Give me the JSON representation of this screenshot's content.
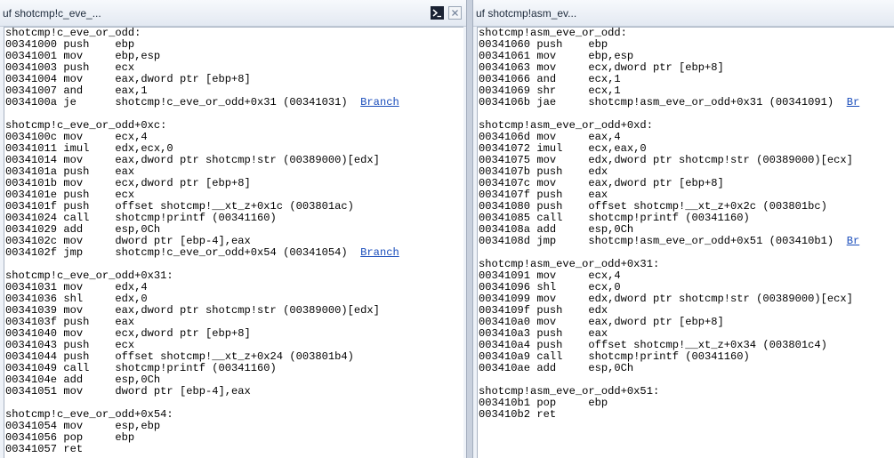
{
  "left": {
    "title": "uf shotcmp!c_eve_...",
    "lines": [
      {
        "text": "shotcmp!c_eve_or_odd:"
      },
      {
        "text": "00341000 push    ebp"
      },
      {
        "text": "00341001 mov     ebp,esp"
      },
      {
        "text": "00341003 push    ecx"
      },
      {
        "text": "00341004 mov     eax,dword ptr [ebp+8]"
      },
      {
        "text": "00341007 and     eax,1"
      },
      {
        "text": "0034100a je      shotcmp!c_eve_or_odd+0x31 (00341031)  ",
        "link": "Branch"
      },
      {
        "text": ""
      },
      {
        "text": "shotcmp!c_eve_or_odd+0xc:"
      },
      {
        "text": "0034100c mov     ecx,4"
      },
      {
        "text": "00341011 imul    edx,ecx,0"
      },
      {
        "text": "00341014 mov     eax,dword ptr shotcmp!str (00389000)[edx]"
      },
      {
        "text": "0034101a push    eax"
      },
      {
        "text": "0034101b mov     ecx,dword ptr [ebp+8]"
      },
      {
        "text": "0034101e push    ecx"
      },
      {
        "text": "0034101f push    offset shotcmp!__xt_z+0x1c (003801ac)"
      },
      {
        "text": "00341024 call    shotcmp!printf (00341160)"
      },
      {
        "text": "00341029 add     esp,0Ch"
      },
      {
        "text": "0034102c mov     dword ptr [ebp-4],eax"
      },
      {
        "text": "0034102f jmp     shotcmp!c_eve_or_odd+0x54 (00341054)  ",
        "link": "Branch"
      },
      {
        "text": ""
      },
      {
        "text": "shotcmp!c_eve_or_odd+0x31:"
      },
      {
        "text": "00341031 mov     edx,4"
      },
      {
        "text": "00341036 shl     edx,0"
      },
      {
        "text": "00341039 mov     eax,dword ptr shotcmp!str (00389000)[edx]"
      },
      {
        "text": "0034103f push    eax"
      },
      {
        "text": "00341040 mov     ecx,dword ptr [ebp+8]"
      },
      {
        "text": "00341043 push    ecx"
      },
      {
        "text": "00341044 push    offset shotcmp!__xt_z+0x24 (003801b4)"
      },
      {
        "text": "00341049 call    shotcmp!printf (00341160)"
      },
      {
        "text": "0034104e add     esp,0Ch"
      },
      {
        "text": "00341051 mov     dword ptr [ebp-4],eax"
      },
      {
        "text": ""
      },
      {
        "text": "shotcmp!c_eve_or_odd+0x54:"
      },
      {
        "text": "00341054 mov     esp,ebp"
      },
      {
        "text": "00341056 pop     ebp"
      },
      {
        "text": "00341057 ret"
      }
    ]
  },
  "right": {
    "title": "uf shotcmp!asm_ev...",
    "lines": [
      {
        "text": "shotcmp!asm_eve_or_odd:"
      },
      {
        "text": "00341060 push    ebp"
      },
      {
        "text": "00341061 mov     ebp,esp"
      },
      {
        "text": "00341063 mov     ecx,dword ptr [ebp+8]"
      },
      {
        "text": "00341066 and     ecx,1"
      },
      {
        "text": "00341069 shr     ecx,1"
      },
      {
        "text": "0034106b jae     shotcmp!asm_eve_or_odd+0x31 (00341091)  ",
        "link": "Br"
      },
      {
        "text": ""
      },
      {
        "text": "shotcmp!asm_eve_or_odd+0xd:"
      },
      {
        "text": "0034106d mov     eax,4"
      },
      {
        "text": "00341072 imul    ecx,eax,0"
      },
      {
        "text": "00341075 mov     edx,dword ptr shotcmp!str (00389000)[ecx]"
      },
      {
        "text": "0034107b push    edx"
      },
      {
        "text": "0034107c mov     eax,dword ptr [ebp+8]"
      },
      {
        "text": "0034107f push    eax"
      },
      {
        "text": "00341080 push    offset shotcmp!__xt_z+0x2c (003801bc)"
      },
      {
        "text": "00341085 call    shotcmp!printf (00341160)"
      },
      {
        "text": "0034108a add     esp,0Ch"
      },
      {
        "text": "0034108d jmp     shotcmp!asm_eve_or_odd+0x51 (003410b1)  ",
        "link": "Br"
      },
      {
        "text": ""
      },
      {
        "text": "shotcmp!asm_eve_or_odd+0x31:"
      },
      {
        "text": "00341091 mov     ecx,4"
      },
      {
        "text": "00341096 shl     ecx,0"
      },
      {
        "text": "00341099 mov     edx,dword ptr shotcmp!str (00389000)[ecx]"
      },
      {
        "text": "0034109f push    edx"
      },
      {
        "text": "003410a0 mov     eax,dword ptr [ebp+8]"
      },
      {
        "text": "003410a3 push    eax"
      },
      {
        "text": "003410a4 push    offset shotcmp!__xt_z+0x34 (003801c4)"
      },
      {
        "text": "003410a9 call    shotcmp!printf (00341160)"
      },
      {
        "text": "003410ae add     esp,0Ch"
      },
      {
        "text": ""
      },
      {
        "text": "shotcmp!asm_eve_or_odd+0x51:"
      },
      {
        "text": "003410b1 pop     ebp"
      },
      {
        "text": "003410b2 ret"
      }
    ]
  }
}
